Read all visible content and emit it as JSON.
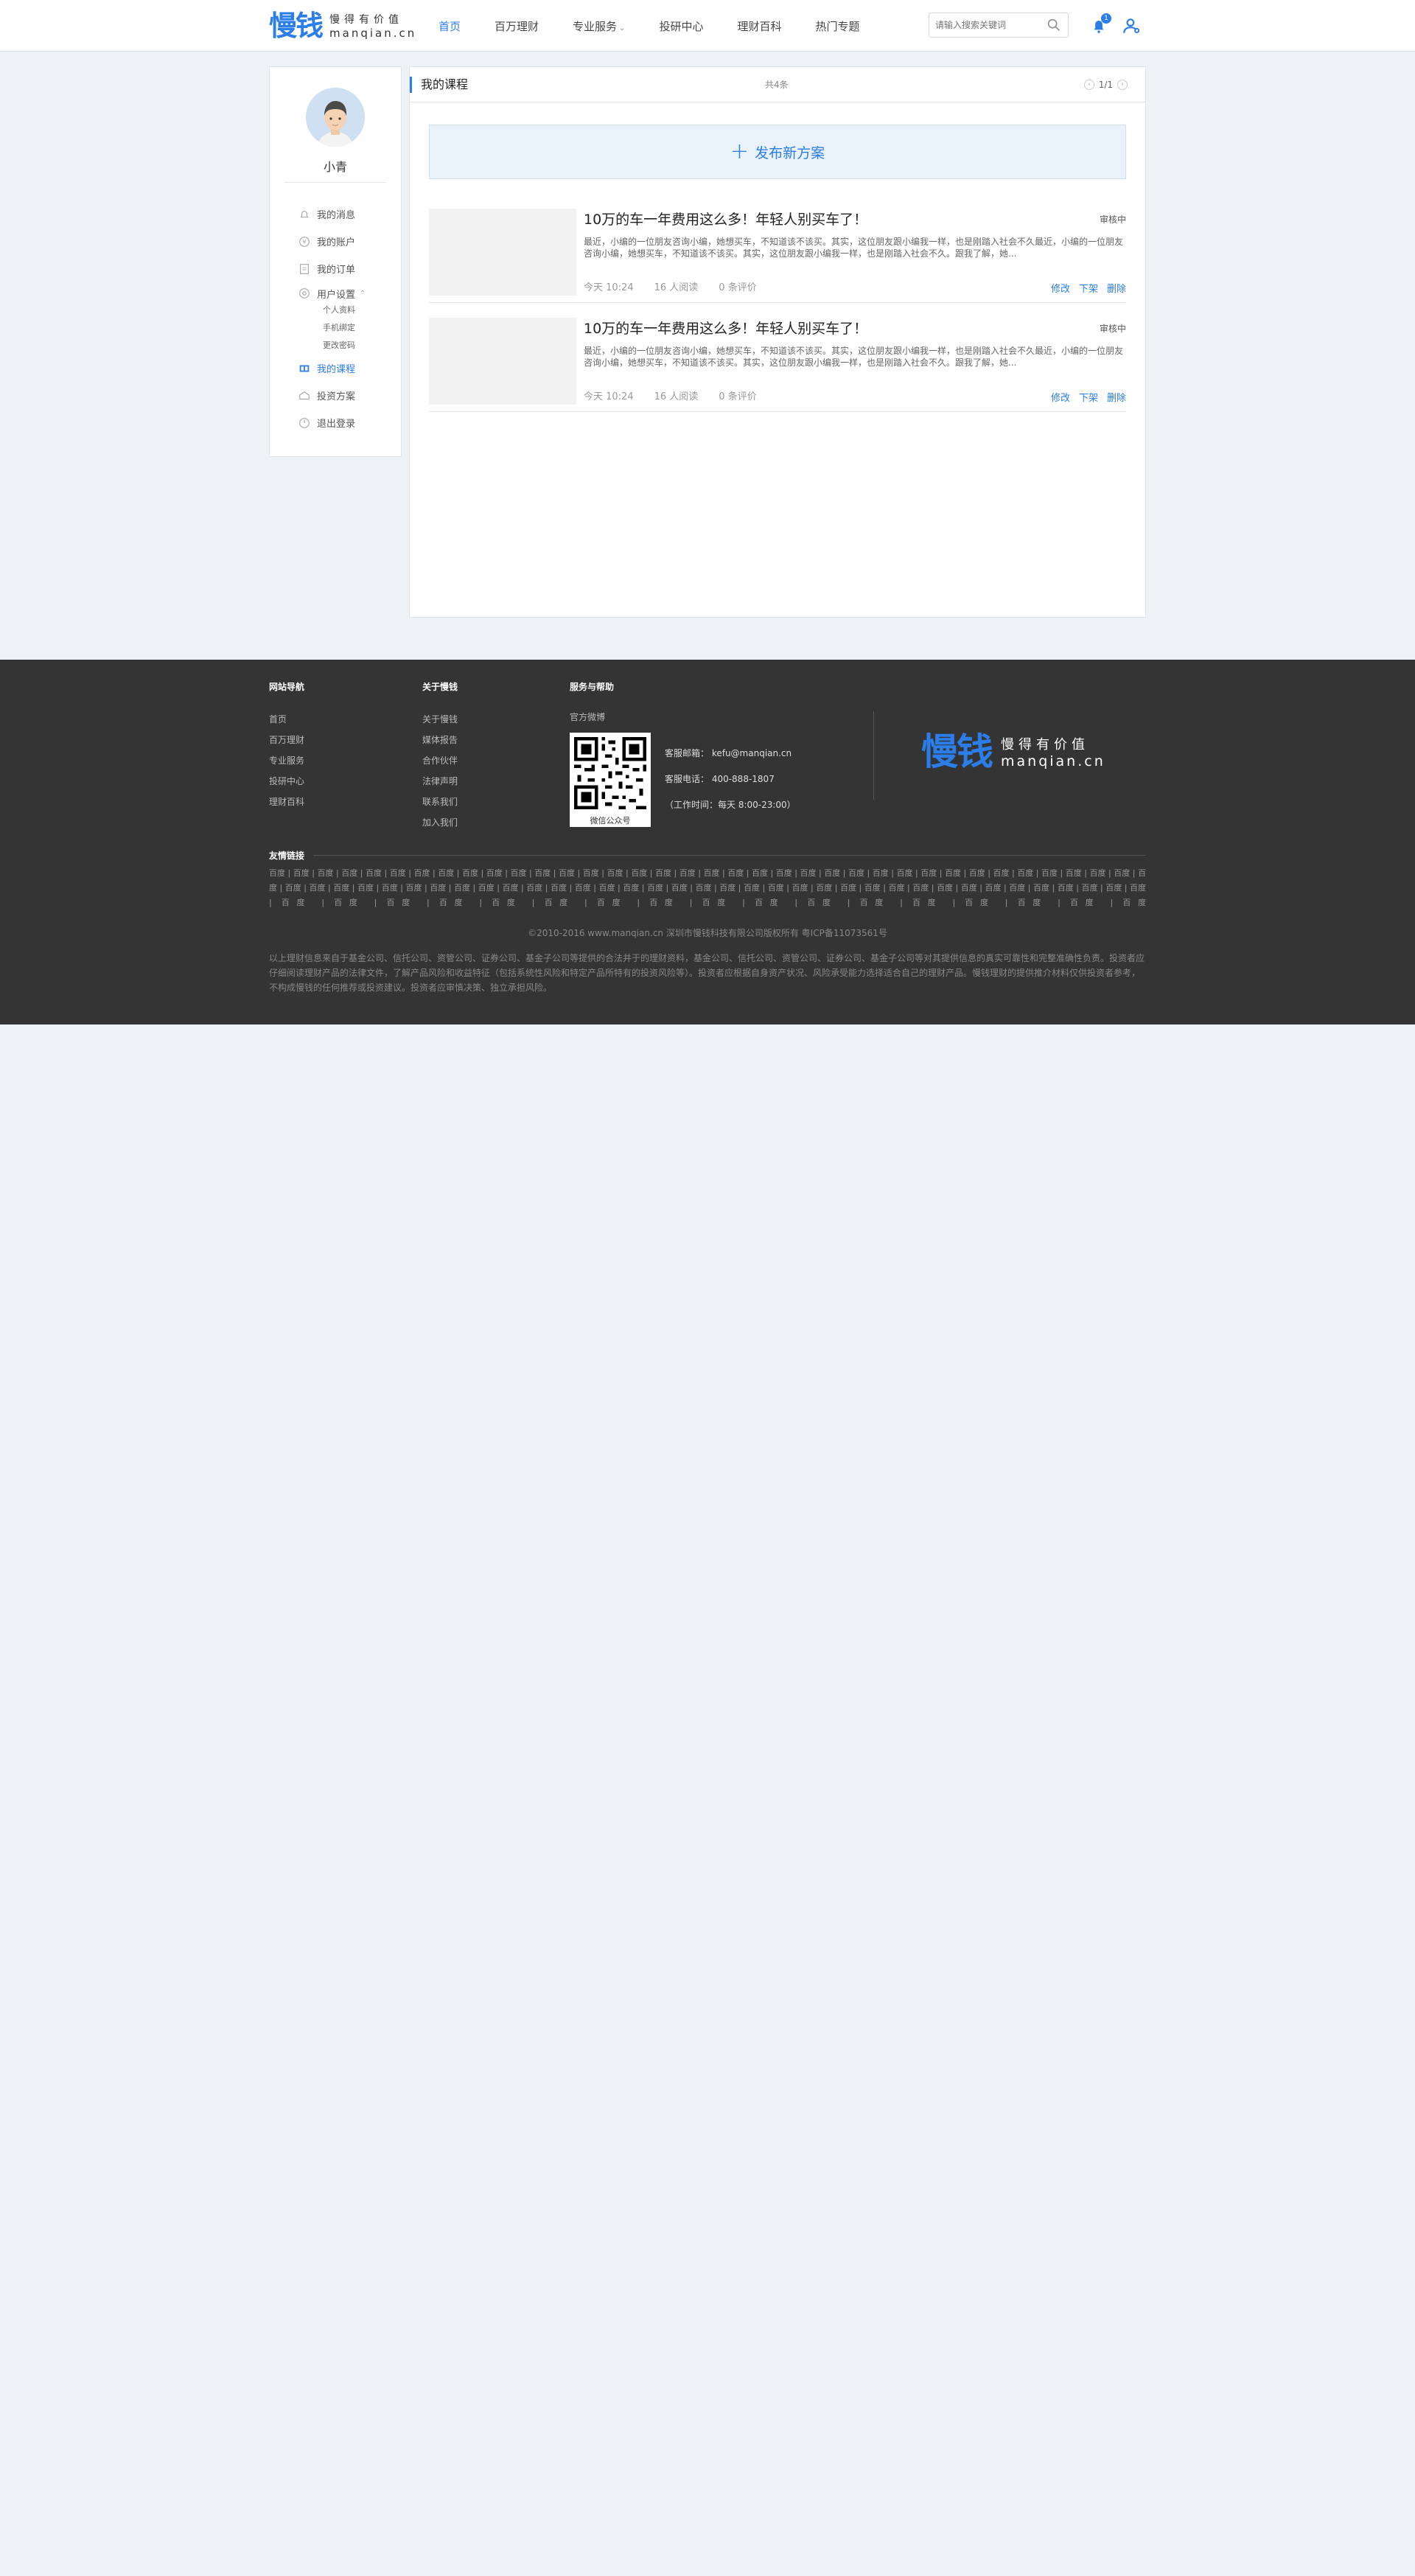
{
  "header": {
    "logo_mark": "慢钱",
    "logo_slogan": "慢得有价值",
    "logo_domain": "manqian.cn",
    "nav": [
      "首页",
      "百万理财",
      "专业服务",
      "投研中心",
      "理财百科",
      "热门专题"
    ],
    "active_nav": "首页",
    "search_placeholder": "请输入搜索关键词",
    "notification_count": "1",
    "colors": {
      "accent": "#2b7de9",
      "footer_bg": "#343434"
    }
  },
  "sidebar": {
    "username": "小青",
    "items": [
      {
        "label": "我的消息",
        "icon": "bell-icon"
      },
      {
        "label": "我的账户",
        "icon": "account-icon"
      },
      {
        "label": "我的订单",
        "icon": "order-icon"
      },
      {
        "label": "用户设置",
        "icon": "settings-icon"
      },
      {
        "label": "我的课程",
        "icon": "course-icon"
      },
      {
        "label": "投资方案",
        "icon": "plan-icon"
      },
      {
        "label": "退出登录",
        "icon": "logout-icon"
      }
    ],
    "sub_items": [
      "个人资料",
      "手机绑定",
      "更改密码"
    ],
    "active": "我的课程"
  },
  "main": {
    "title": "我的课程",
    "count": "共4条",
    "pager": "1/1",
    "publish_label": "发布新方案",
    "articles": [
      {
        "title": "10万的车一年费用这么多！年轻人别买车了！",
        "status": "审核中",
        "desc": "最近，小编的一位朋友咨询小编，她想买车，不知道该不该买。其实，这位朋友跟小编我一样，也是刚踏入社会不久最近，小编的一位朋友咨询小编，她想买车，不知道该不该买。其实，这位朋友跟小编我一样，也是刚踏入社会不久。跟我了解，她...",
        "time": "今天 10:24",
        "reads": "16 人阅读",
        "comments": "0 条评价",
        "actions": [
          "修改",
          "下架",
          "删除"
        ]
      },
      {
        "title": "10万的车一年费用这么多！年轻人别买车了！",
        "status": "审核中",
        "desc": "最近，小编的一位朋友咨询小编，她想买车，不知道该不该买。其实，这位朋友跟小编我一样，也是刚踏入社会不久最近，小编的一位朋友咨询小编，她想买车，不知道该不该买。其实，这位朋友跟小编我一样，也是刚踏入社会不久。跟我了解，她...",
        "time": "今天 10:24",
        "reads": "16 人阅读",
        "comments": "0 条评价",
        "actions": [
          "修改",
          "下架",
          "删除"
        ]
      }
    ]
  },
  "footer": {
    "col1_title": "网站导航",
    "col1_links": [
      "首页",
      "百万理财",
      "专业服务",
      "投研中心",
      "理财百科"
    ],
    "col2_title": "关于慢钱",
    "col2_links": [
      "关于慢钱",
      "媒体报告",
      "合作伙伴",
      "法律声明",
      "联系我们",
      "加入我们"
    ],
    "col3_title": "服务与帮助",
    "weibo": "官方微博",
    "qr_caption": "微信公众号",
    "email": "客服邮箱：  kefu@manqian.cn",
    "phone": "客服电话：  400-888-1807",
    "hours": "（工作时间：每天 8:00-23:00）",
    "friend_title": "友情链接",
    "friend_links": "百度 | 百度 | 百度 | 百度 | 百度 | 百度 | 百度 | 百度 | 百度 | 百度 | 百度 | 百度 | 百度 | 百度 | 百度 | 百度 | 百度 | 百度 | 百度 | 百度 | 百度 | 百度 | 百度 | 百度 | 百度 | 百度 | 百度 | 百度 | 百度 | 百度 | 百度 | 百度 | 百度 | 百度 | 百度 | 百度 | 百度 | 百度 | 百度 | 百度 | 百度 | 百度 | 百度 | 百度 | 百度 | 百度 | 百度 | 百度 | 百度 | 百度 | 百度 | 百度 | 百度 | 百度 | 百度 | 百度 | 百度 | 百度 | 百度 | 百度 | 百度 | 百度 | 百度 | 百度 | 百度 | 百度 | 百度 | 百度 | 百度 | 百度 | 百度 | 百度 | 百度 | 百度 | 百度 | 百度 | 百度 | 百度 | 百度 | 百度 | 百度 | 百度 | 百度 | 百度 | 百度 | 百度 | 百度 | 百度 | 百度 | 百度",
    "copyright": "©2010-2016 www.manqian.cn 深圳市慢钱科技有限公司版权所有   粤ICP备11073561号",
    "disclaimer": "以上理财信息来自于基金公司、信托公司、资管公司、证券公司、基金子公司等提供的合法并于的理财资料，基金公司、信托公司、资管公司、证券公司、基金子公司等对其提供信息的真实可靠性和完整准确性负责。投资者应仔细阅读理财产品的法律文件，了解产品风险和收益特征（包括系统性风险和特定产品所特有的投资风险等）。投资者应根据自身资产状况、风险承受能力选择适合自己的理财产品。慢钱理财的提供推介材料仅供投资者参考，不构成慢钱的任何推荐或投资建议。投资者应审慎决策、独立承担风险。"
  }
}
